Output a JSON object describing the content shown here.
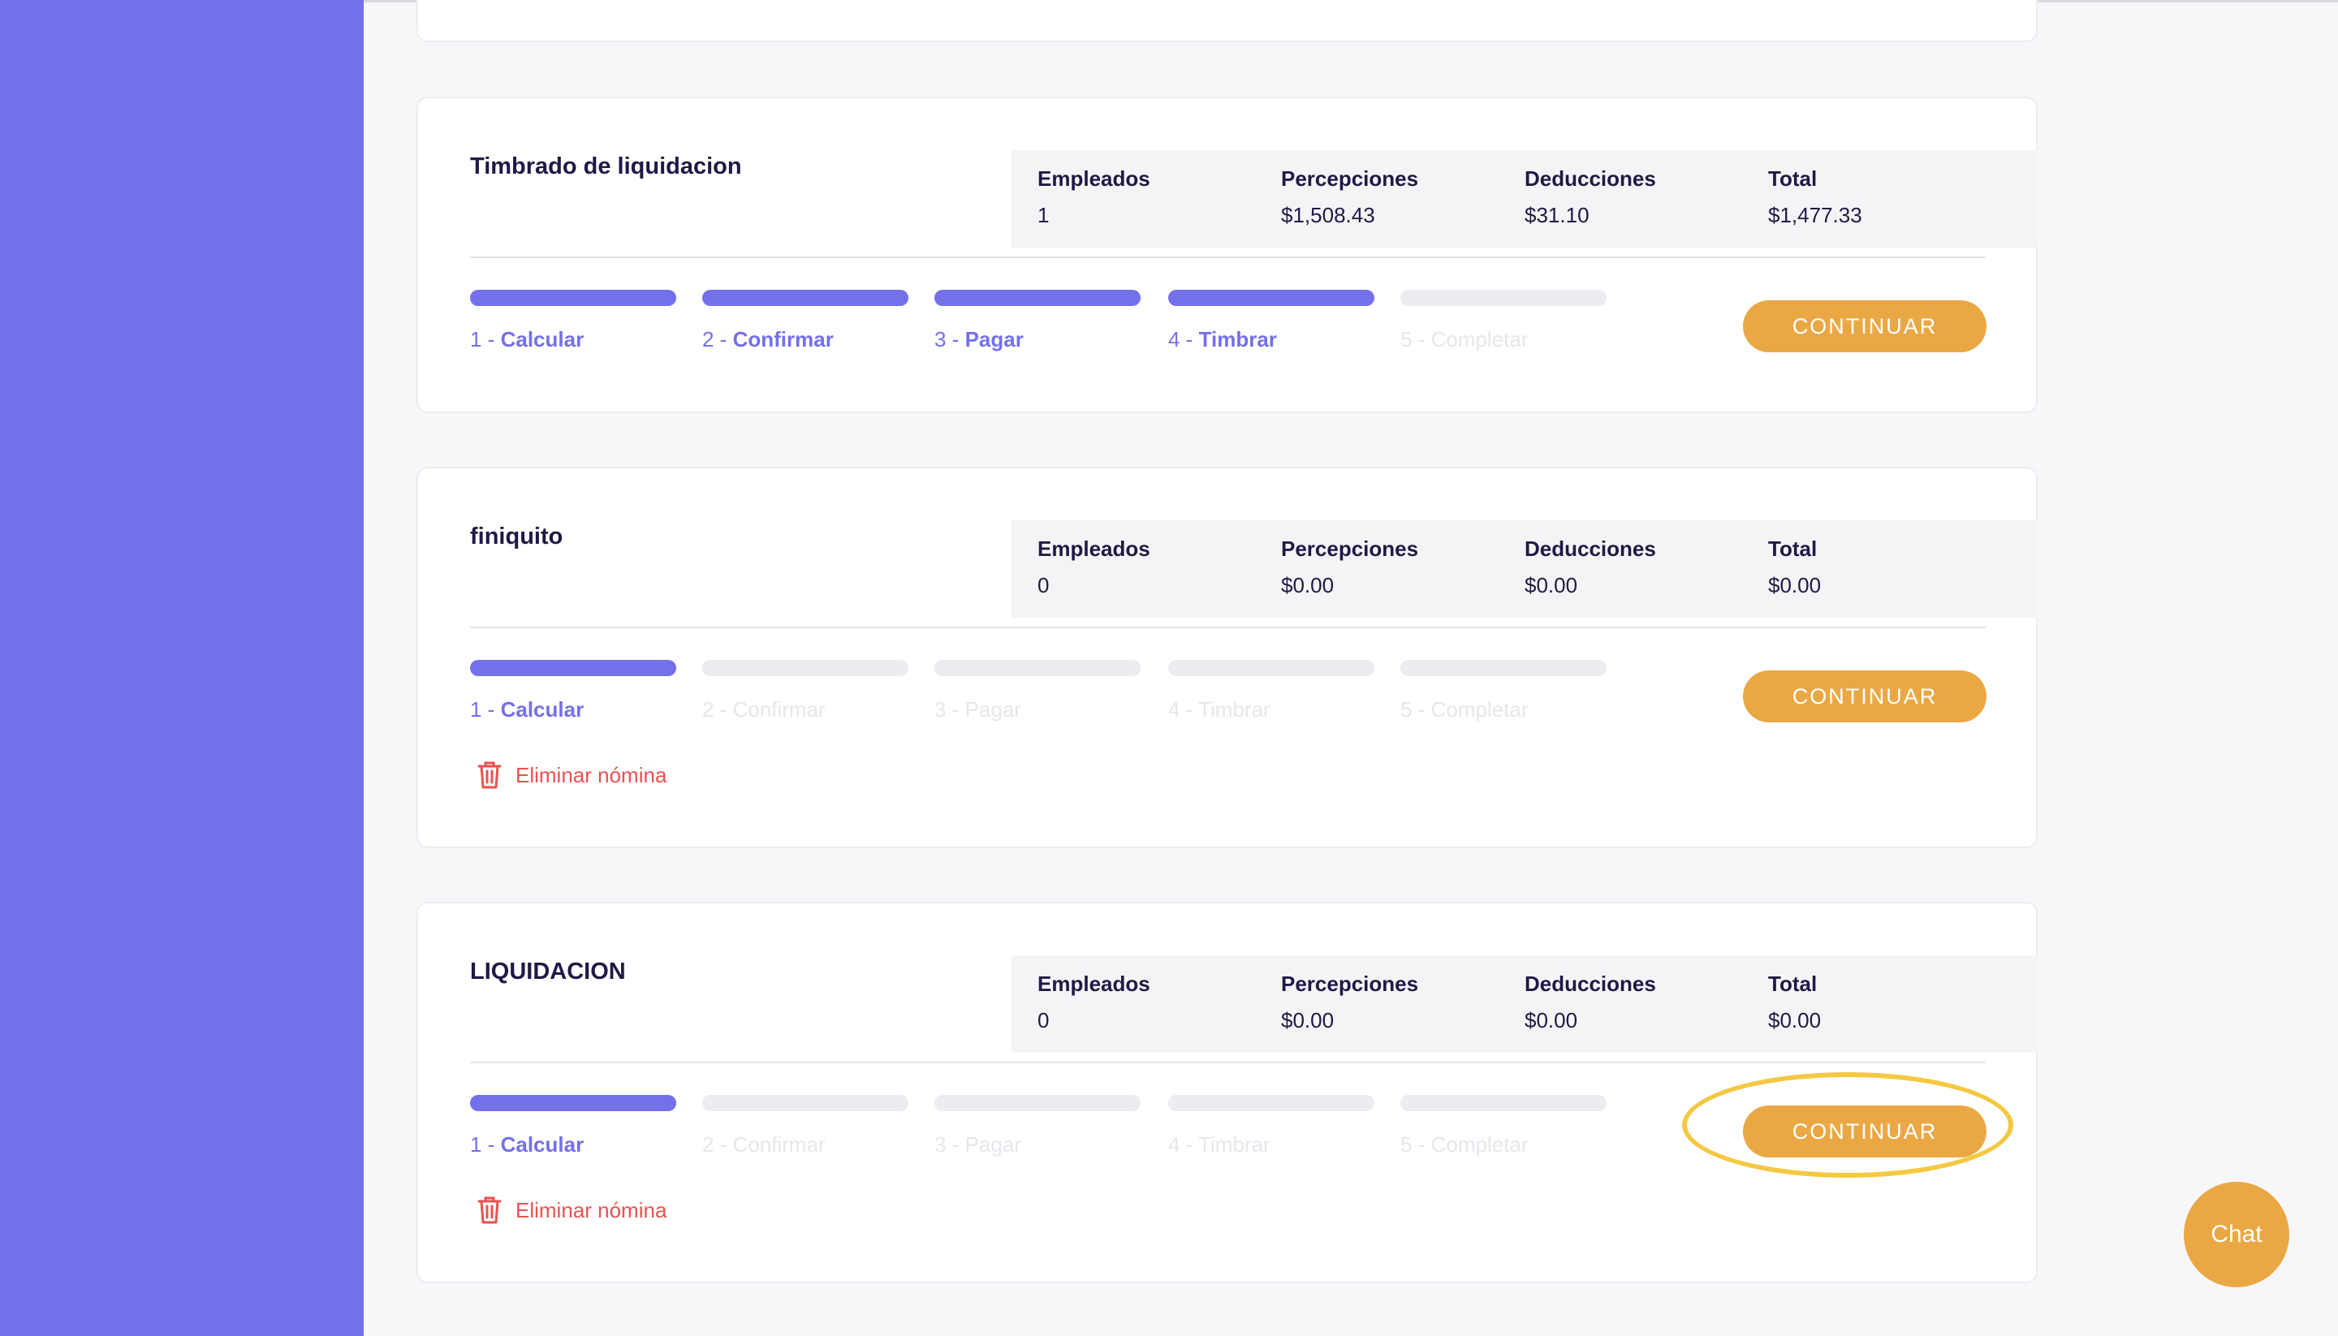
{
  "colors": {
    "sidebar": "#7470ea",
    "accent": "#7470ea",
    "button": "#eaa845",
    "danger": "#e8524f",
    "highlight": "#f5c842"
  },
  "summary_labels": {
    "employees": "Empleados",
    "perceptions": "Percepciones",
    "deductions": "Deducciones",
    "total": "Total"
  },
  "continue_label": "CONTINUAR",
  "delete_label": "Eliminar nómina",
  "chat_label": "Chat",
  "payrolls": [
    {
      "title": "Timbrado de liquidacion",
      "employees": "1",
      "perceptions": "$1,508.43",
      "deductions": "$31.10",
      "total": "$1,477.33",
      "steps": [
        {
          "num": "1 - ",
          "name": "Calcular",
          "done": true
        },
        {
          "num": "2 - ",
          "name": "Confirmar",
          "done": true
        },
        {
          "num": "3 - ",
          "name": "Pagar",
          "done": true
        },
        {
          "num": "4 - ",
          "name": "Timbrar",
          "done": true
        },
        {
          "num": "5 - ",
          "name": "Completar",
          "done": false
        }
      ],
      "show_delete": false
    },
    {
      "title": "finiquito",
      "employees": "0",
      "perceptions": "$0.00",
      "deductions": "$0.00",
      "total": "$0.00",
      "steps": [
        {
          "num": "1 - ",
          "name": "Calcular",
          "done": true
        },
        {
          "num": "2 - ",
          "name": "Confirmar",
          "done": false
        },
        {
          "num": "3 - ",
          "name": "Pagar",
          "done": false
        },
        {
          "num": "4 - ",
          "name": "Timbrar",
          "done": false
        },
        {
          "num": "5 - ",
          "name": "Completar",
          "done": false
        }
      ],
      "show_delete": true
    },
    {
      "title": "LIQUIDACION",
      "employees": "0",
      "perceptions": "$0.00",
      "deductions": "$0.00",
      "total": "$0.00",
      "steps": [
        {
          "num": "1 - ",
          "name": "Calcular",
          "done": true
        },
        {
          "num": "2 - ",
          "name": "Confirmar",
          "done": false
        },
        {
          "num": "3 - ",
          "name": "Pagar",
          "done": false
        },
        {
          "num": "4 - ",
          "name": "Timbrar",
          "done": false
        },
        {
          "num": "5 - ",
          "name": "Completar",
          "done": false
        }
      ],
      "show_delete": true
    }
  ]
}
